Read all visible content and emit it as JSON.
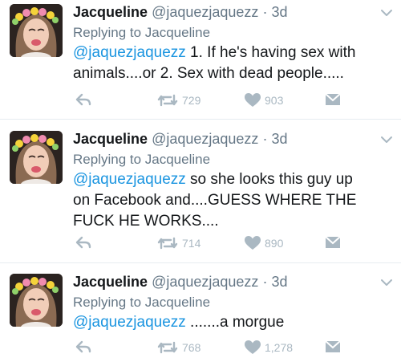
{
  "tweets": [
    {
      "name": "Jacqueline",
      "handle": "@jaquezjaquezz",
      "separator": "·",
      "time": "3d",
      "replying": "Replying to Jacqueline",
      "mention": "@jaquezjaquezz",
      "text_line1": " 1. If he's having sex with",
      "text_line2": "animals....or 2. Sex with dead people.....",
      "text_line3": "",
      "retweets": "729",
      "likes": "903"
    },
    {
      "name": "Jacqueline",
      "handle": "@jaquezjaquezz",
      "separator": "·",
      "time": "3d",
      "replying": "Replying to Jacqueline",
      "mention": "@jaquezjaquezz",
      "text_line1": " so she looks this guy up",
      "text_line2": "on Facebook and....GUESS WHERE THE",
      "text_line3": "FUCK HE WORKS....",
      "retweets": "714",
      "likes": "890"
    },
    {
      "name": "Jacqueline",
      "handle": "@jaquezjaquezz",
      "separator": "·",
      "time": "3d",
      "replying": "Replying to Jacqueline",
      "mention": "@jaquezjaquezz",
      "text_line1": " .......a morgue",
      "text_line2": "",
      "text_line3": "",
      "retweets": "768",
      "likes": "1,278"
    }
  ],
  "icons": {
    "reply": "reply-icon",
    "retweet": "retweet-icon",
    "like": "heart-icon",
    "dm": "envelope-icon",
    "more": "chevron-down-icon"
  },
  "colors": {
    "mention": "#1b95e0",
    "meta": "#657786",
    "action": "#aab8c2",
    "divider": "#e6ecf0"
  }
}
